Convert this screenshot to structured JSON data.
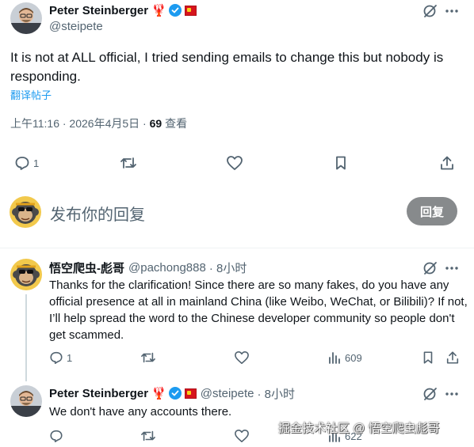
{
  "main_post": {
    "author_name": "Peter Steinberger",
    "handle": "@steipete",
    "badge_emoji": "🦞",
    "text": "It is not at ALL official, I tried sending emails to change this but nobody is responding.",
    "translate_label": "翻译帖子",
    "time": "上午11:16 · 2026年4月5日 · ",
    "views_count": "69",
    "views_label": " 查看",
    "reply_count": "1"
  },
  "composer": {
    "placeholder": "发布你的回复",
    "reply_button": "回复"
  },
  "reply_1": {
    "author_name": "悟空爬虫-彪哥",
    "handle": "@pachong888",
    "time": "· 8小时",
    "text": "Thanks for the clarification! Since there are so many fakes, do you have any official presence at all in mainland China (like Weibo, WeChat, or Bilibili)? If not, I’ll help spread the word to the Chinese developer community so people don't get scammed.",
    "reply_count": "1",
    "views": "609"
  },
  "reply_2": {
    "author_name": "Peter Steinberger",
    "badge_emoji": "🦞",
    "handle": "@steipete",
    "time": "· 8小时",
    "text": "We don't have any accounts there.",
    "views": "622"
  },
  "watermark": "掘金技术社区 @ 悟空爬虫彪哥",
  "colors": {
    "link": "#1d9bf0",
    "verified": "#1d9bf0",
    "reply_button_bg": "#878a8c"
  }
}
